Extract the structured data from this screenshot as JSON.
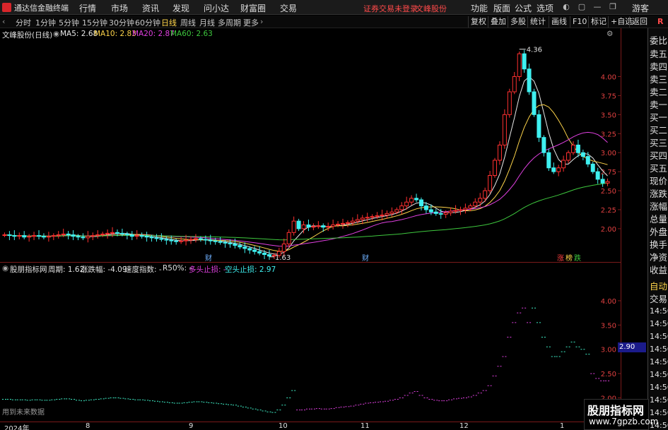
{
  "app": {
    "name": "通达信金融终端",
    "alert": "证券交易未登录",
    "stock_link": "文峰股份"
  },
  "menu": [
    "行情",
    "市场",
    "资讯",
    "发现",
    "问小达",
    "财富圈",
    "交易"
  ],
  "toolbar": [
    "功能",
    "版面",
    "公式",
    "选项"
  ],
  "guest": "游客",
  "period_tabs": [
    "分时",
    "1分钟",
    "5分钟",
    "15分钟",
    "30分钟",
    "60分钟",
    "日线",
    "周线",
    "月线",
    "多周期",
    "更多"
  ],
  "period_active": "日线",
  "chart_buttons": [
    "复权",
    "叠加",
    "多股",
    "统计",
    "画线",
    "F10",
    "标记",
    "+自选",
    "返回"
  ],
  "stock_title": "文峰股份(日线)",
  "ma_labels": [
    {
      "text": "MA5: 2.68",
      "color": "#e8e8e8"
    },
    {
      "text": "MA10: 2.83",
      "color": "#ffd54a"
    },
    {
      "text": "MA20: 2.87",
      "color": "#e040e0"
    },
    {
      "text": "MA60: 2.63",
      "color": "#3ec83e"
    }
  ],
  "price_axis_ticks": [
    "4.00",
    "3.75",
    "3.50",
    "3.25",
    "3.00",
    "2.75",
    "2.50",
    "2.25",
    "2.00"
  ],
  "high_label": "4.36",
  "low_label": "1.63",
  "chart_markers": [
    {
      "text": "财",
      "color": "#6fb0ff"
    },
    {
      "text": "涨",
      "color": "#ff4040"
    },
    {
      "text": "榜",
      "color": "#ffd54a"
    },
    {
      "text": "跌",
      "color": "#3ec83e"
    }
  ],
  "sub_info": {
    "name": "股朋指标网",
    "period": "周期: 1.62",
    "change": "涨跌幅: -4.09",
    "speed": "速度指数: -",
    "r50": "R50%: -",
    "long_stop": "多头止损: -",
    "short_stop": "空头止损: 2.97"
  },
  "sub_axis_ticks": [
    "4.00",
    "3.50",
    "3.00",
    "2.50",
    "2.00"
  ],
  "sub_price_box": "2.90",
  "sub_note": "用到未来数据",
  "x_labels": [
    "2024年",
    "8",
    "9",
    "10",
    "11",
    "12",
    "1"
  ],
  "right_panel": [
    "委比",
    "卖五",
    "卖四",
    "卖三",
    "卖二",
    "卖一",
    "买一",
    "买二",
    "买三",
    "买四",
    "买五",
    "现价",
    "涨跌",
    "涨幅",
    "总量",
    "外盘",
    "换手",
    "净资",
    "收益"
  ],
  "right_panel_bottom": [
    "自动",
    "交易"
  ],
  "right_times": [
    "14:56",
    "14:56",
    "14:56",
    "14:56",
    "14:56",
    "14:56",
    "14:56",
    "14:56",
    "14:56",
    "14:56"
  ],
  "watermark": {
    "line1": "股朋指标网",
    "line2": "www.7gpzb.com"
  },
  "colors": {
    "up": "#ff3030",
    "down": "#3ff0f0",
    "ma5": "#e8e8e8",
    "ma10": "#ffd54a",
    "ma20": "#e040e0",
    "ma60": "#3ec83e",
    "accent": "#ffd54a",
    "sub_dash_long": "#e040e0",
    "sub_dash_short": "#3ff0c8"
  },
  "chart_data": {
    "type": "candlestick",
    "x_ticks": [
      "2024年",
      "8",
      "9",
      "10",
      "11",
      "12",
      "1"
    ],
    "price_range": [
      1.6,
      4.45
    ],
    "high": 4.36,
    "low": 1.63,
    "close_series": [
      1.92,
      1.91,
      1.9,
      1.91,
      1.89,
      1.9,
      1.91,
      1.9,
      1.89,
      1.9,
      1.91,
      1.92,
      1.93,
      1.92,
      1.9,
      1.89,
      1.88,
      1.9,
      1.91,
      1.92,
      1.93,
      1.94,
      1.95,
      1.94,
      1.93,
      1.92,
      1.9,
      1.91,
      1.9,
      1.89,
      1.88,
      1.87,
      1.86,
      1.85,
      1.84,
      1.83,
      1.84,
      1.85,
      1.86,
      1.87,
      1.86,
      1.85,
      1.84,
      1.83,
      1.82,
      1.81,
      1.8,
      1.78,
      1.76,
      1.74,
      1.72,
      1.7,
      1.68,
      1.66,
      1.64,
      1.65,
      1.7,
      1.8,
      1.95,
      2.1,
      2.0,
      2.05,
      2.02,
      2.03,
      2.04,
      2.02,
      2.03,
      2.05,
      2.06,
      2.07,
      2.08,
      2.1,
      2.12,
      2.14,
      2.15,
      2.16,
      2.17,
      2.18,
      2.2,
      2.22,
      2.25,
      2.3,
      2.35,
      2.4,
      2.38,
      2.3,
      2.25,
      2.22,
      2.2,
      2.19,
      2.21,
      2.23,
      2.24,
      2.25,
      2.27,
      2.3,
      2.35,
      2.4,
      2.5,
      2.7,
      2.9,
      3.1,
      3.5,
      3.8,
      4.0,
      4.3,
      4.1,
      3.8,
      3.5,
      3.2,
      3.0,
      2.8,
      2.75,
      2.8,
      2.9,
      3.0,
      3.1,
      3.0,
      2.95,
      2.85,
      2.75,
      2.65,
      2.6,
      2.62
    ]
  }
}
